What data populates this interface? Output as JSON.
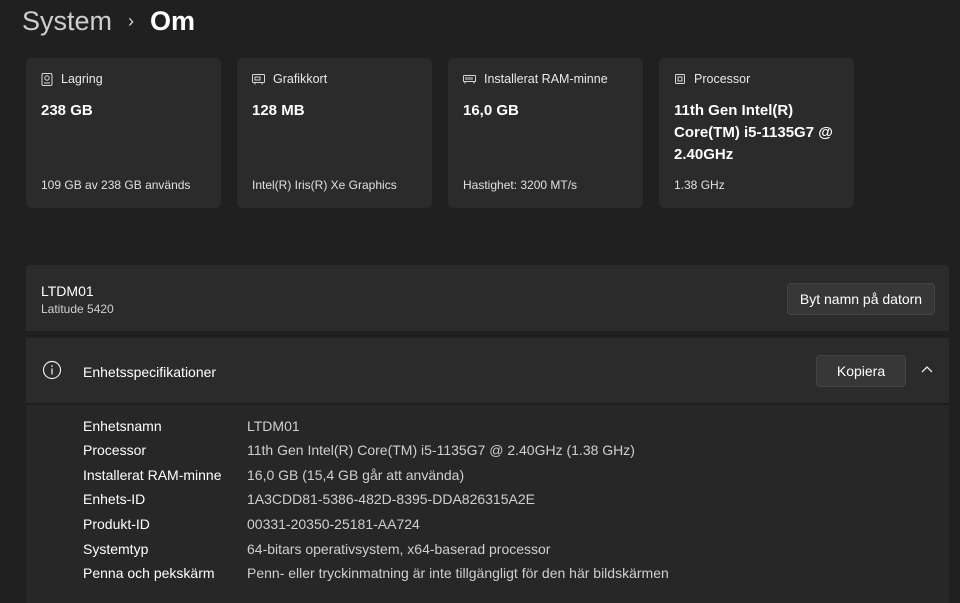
{
  "breadcrumb": {
    "parent": "System",
    "separator": "›",
    "current": "Om"
  },
  "cards": [
    {
      "icon": "storage-icon",
      "title": "Lagring",
      "value": "238 GB",
      "sub": "109 GB av 238 GB används"
    },
    {
      "icon": "graphics-card-icon",
      "title": "Grafikkort",
      "value": "128 MB",
      "sub": "Intel(R) Iris(R) Xe Graphics"
    },
    {
      "icon": "ram-icon",
      "title": "Installerat RAM-minne",
      "value": "16,0 GB",
      "sub": "Hastighet: 3200 MT/s"
    },
    {
      "icon": "processor-icon",
      "title": "Processor",
      "value": "11th Gen Intel(R) Core(TM) i5-1135G7 @ 2.40GHz",
      "sub": "1.38 GHz"
    }
  ],
  "device": {
    "name": "LTDM01",
    "model": "Latitude 5420",
    "rename_label": "Byt namn på datorn"
  },
  "specs": {
    "title": "Enhetsspecifikationer",
    "copy_label": "Kopiera",
    "rows": [
      {
        "label": "Enhetsnamn",
        "value": "LTDM01"
      },
      {
        "label": "Processor",
        "value": "11th Gen Intel(R) Core(TM) i5-1135G7 @ 2.40GHz (1.38 GHz)"
      },
      {
        "label": "Installerat RAM-minne",
        "value": "16,0 GB (15,4 GB går att använda)"
      },
      {
        "label": "Enhets-ID",
        "value": "1A3CDD81-5386-482D-8395-DDA826315A2E"
      },
      {
        "label": "Produkt-ID",
        "value": "00331-20350-25181-AA724"
      },
      {
        "label": "Systemtyp",
        "value": "64-bitars operativsystem, x64-baserad processor"
      },
      {
        "label": "Penna och pekskärm",
        "value": "Penn- eller tryckinmatning är inte tillgängligt för den här bildskärmen"
      }
    ]
  }
}
